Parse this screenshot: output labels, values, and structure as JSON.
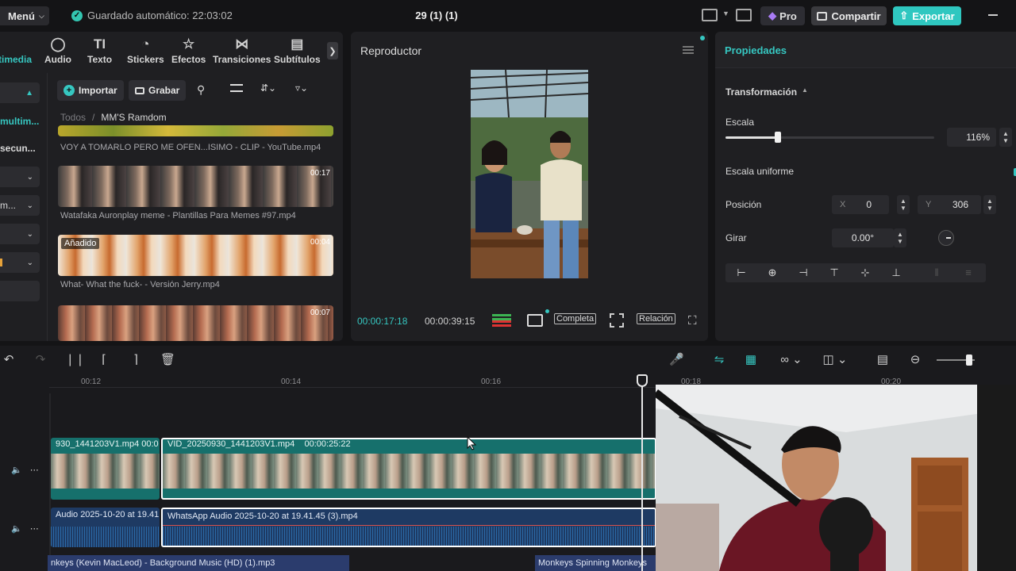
{
  "topbar": {
    "menu_label": "Menú",
    "autosave_label": "Guardado automático: 22:03:02",
    "project_title": "29 (1) (1)",
    "pro_label": "Pro",
    "share_label": "Compartir",
    "export_label": "Exportar"
  },
  "media_tabs": [
    {
      "label": "timedia",
      "icon": "multimedia-icon"
    },
    {
      "label": "Audio",
      "icon": "audio-icon"
    },
    {
      "label": "Texto",
      "icon": "text-icon"
    },
    {
      "label": "Stickers",
      "icon": "sticker-icon"
    },
    {
      "label": "Efectos",
      "icon": "effects-icon"
    },
    {
      "label": "Transiciones",
      "icon": "transitions-icon"
    },
    {
      "label": "Subtítulos",
      "icon": "subtitles-icon"
    }
  ],
  "sidebar": {
    "items": [
      {
        "label": "multim..."
      },
      {
        "label": "secun..."
      },
      {
        "label": "m..."
      }
    ]
  },
  "media": {
    "import_label": "Importar",
    "record_label": "Grabar",
    "breadcrumb_all": "Todos",
    "breadcrumb_sep": "/",
    "breadcrumb_folder": "MM'S Ramdom",
    "clips": [
      {
        "caption": "VOY A TOMARLO PERO ME OFEN...ISIMO - CLIP - YouTube.mp4",
        "duration": ""
      },
      {
        "caption": "Watafaka Auronplay meme - Plantillas Para Memes #97.mp4",
        "duration": "00:17"
      },
      {
        "caption": "What- What the fuck- - Versión Jerry.mp4",
        "duration": "00:04",
        "badge": "Añadido"
      },
      {
        "caption": "",
        "duration": "00:07"
      }
    ]
  },
  "player": {
    "title": "Reproductor",
    "current_time": "00:00:17:18",
    "total_time": "00:00:39:15",
    "complete_label": "Completa",
    "ratio_label": "Relación"
  },
  "properties": {
    "title": "Propiedades",
    "section": "Transformación",
    "scale_label": "Escala",
    "scale_value": "116%",
    "scale_fraction": 0.25,
    "uniform_label": "Escala uniforme",
    "position_label": "Posición",
    "x_label": "X",
    "x_value": "0",
    "y_label": "Y",
    "y_value": "306",
    "rotate_label": "Girar",
    "rotate_value": "0.00°"
  },
  "timeline": {
    "ticks": [
      "00:12",
      "00:14",
      "00:16",
      "00:18",
      "00:20"
    ],
    "video_clip_prev_label": "930_1441203V1.mp4   00:0",
    "video_clip_label": "VID_20250930_1441203V1.mp4",
    "video_clip_duration": "00:00:25:22",
    "audio_clip_prev_label": "Audio 2025-10-20 at 19.41.",
    "audio_clip_label": "WhatsApp Audio 2025-10-20 at 19.41.45 (3).mp4",
    "music_clip_1": "nkeys (Kevin MacLeod) - Background Music (HD) (1).mp3",
    "music_clip_2": "Monkeys Spinning Monkeys"
  },
  "colors": {
    "accent": "#36c7c1",
    "video_track": "#16706c",
    "audio_track": "#1e3a63",
    "background": "#141416"
  }
}
